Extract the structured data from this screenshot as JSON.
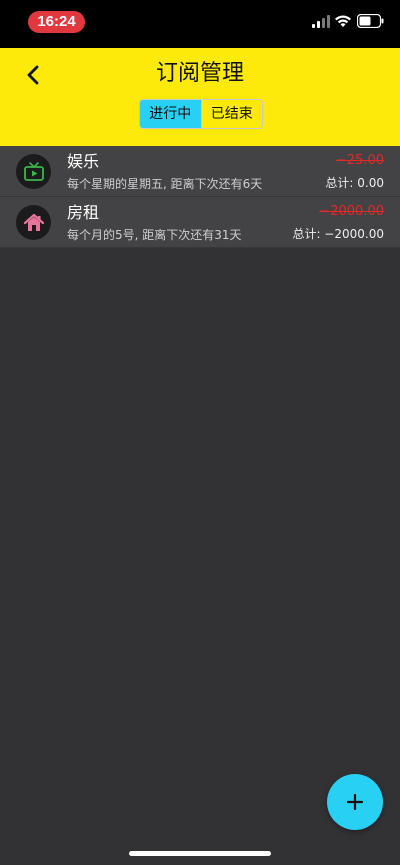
{
  "status_bar": {
    "time": "16:24",
    "time_pill_color": "#e0383e"
  },
  "header": {
    "title": "订阅管理",
    "background": "#fdea0a",
    "back_icon": "chevron-left-icon",
    "tabs": [
      {
        "label": "进行中",
        "active": true
      },
      {
        "label": "已结束",
        "active": false
      }
    ],
    "active_tab_color": "#28d0f3"
  },
  "subscriptions": [
    {
      "name": "娱乐",
      "icon": "tv-icon",
      "icon_color": "#3bb54a",
      "description": "每个星期的星期五, 距离下次还有6天",
      "amount": "−25.00",
      "total": "总计: 0.00"
    },
    {
      "name": "房租",
      "icon": "house-icon",
      "icon_color": "#e8749b",
      "description": "每个月的5号, 距离下次还有31天",
      "amount": "−2000.00",
      "total": "总计: −2000.00"
    }
  ],
  "fab": {
    "icon": "plus-icon",
    "color": "#28d0f3"
  },
  "colors": {
    "amount_color": "#e02a2a",
    "list_background": "#323134",
    "row_background": "#434245"
  }
}
